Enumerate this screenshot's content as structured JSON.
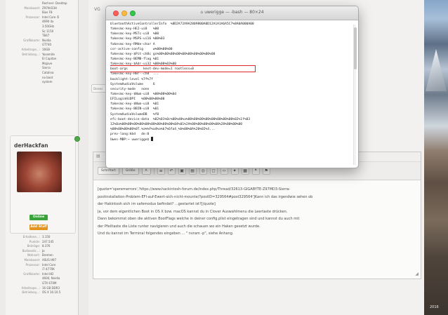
{
  "terminal": {
    "title": "uwerigge — -bash — 80×24",
    "lines": [
      "bluetoothActiveControllerInfo  %8D2A72A9A2809800A0D12A1A1A6A5C7%8A0A000A00",
      "fakesmc-key-HE2-ui8   %00",
      "fakesmc-key-MSTc-ui8  %00",
      "fakesmc-key-MSPS-ui16 %00%03",
      "fakesmc-key-RMde-char A",
      "csr-active-config     w%00%00%00",
      "fakesmc-key-$Pit-ch8c gs%00%00%00%00%00%00%00%00%00%00",
      "fakesmc-key-BEMB-flag %01",
      "fakesmc-key-$Adr-ui32 %00%00%03%00"
    ],
    "highlight_line": "boot-args        kext-dev-mode=1 rootless=0",
    "lines_after": [
      "fakesmc-key-RBr--ch8  ...",
      "backlight-level %7f%7f",
      "SystemAudioVolume     6",
      "security-mode   none",
      "fakesmc-key-$Num-ui8  %00%00%00%0d",
      "EFILoginHiDPI   %00%00%00%00",
      "fakesmc-key-$Num-ui8  %01",
      "fakesmc-key-BBIN-ui8  %01",
      "SystemAudioVolumeDB   %f0",
      "efi-boot-device-data  %02%01%0c%00%d0%a%00%00%00%00%00%00%00%00%02%1f%03",
      "12%0a%00%00%00%00%00%00%00%00%00%04%01%2A%00%00%00%00%00%28%00%00%00",
      "%00%00%00%00%0T.%a%%F%a4%a%b7%6fa4_%b%00%0A%20%02%4...",
      "prev-lang:kbd   de:0",
      "Uwes-MBP:~ uwerigge$ "
    ]
  },
  "forum": {
    "vg_label": "VG",
    "left_top_info": [
      {
        "k": "",
        "v": "Rechner: Desktop"
      },
      {
        "k": "Mainboard:",
        "v": "Z97N-D3H"
      },
      {
        "k": "",
        "v": "Bios F8"
      },
      {
        "k": "Prozessor:",
        "v": "Intel Core i5"
      },
      {
        "k": "",
        "v": "4690 4x"
      },
      {
        "k": "",
        "v": "3.50GHz"
      },
      {
        "k": "",
        "v": "Sc 1150"
      },
      {
        "k": "",
        "v": "TB47"
      },
      {
        "k": "Grafikkarte:",
        "v": "Nvidia"
      },
      {
        "k": "",
        "v": "GT740"
      },
      {
        "k": "Arbeitsspe...:",
        "v": "16GB"
      },
      {
        "k": "Betriebssy...:",
        "v": "Yosemite"
      },
      {
        "k": "",
        "v": "El Capitan"
      },
      {
        "k": "",
        "v": "Mojave"
      },
      {
        "k": "",
        "v": "Sierra"
      },
      {
        "k": "",
        "v": "Catalina"
      },
      {
        "k": "",
        "v": "no boot"
      },
      {
        "k": "",
        "v": "system"
      }
    ],
    "username": "derHackfan",
    "badge_online": "Online",
    "badge_rank": "Add Staff",
    "left_bottom_info": [
      {
        "k": "Erhaltene...:",
        "v": "3.150"
      },
      {
        "k": "Punkte:",
        "v": "247.545"
      },
      {
        "k": "Beiträge:",
        "v": "8.376"
      },
      {
        "k": "Barbeodic...:",
        "v": "Ja"
      },
      {
        "k": "Wohnort:",
        "v": "Bremen"
      },
      {
        "k": "Mainboard:",
        "v": "ASUS H97"
      },
      {
        "k": "Prozessor:",
        "v": "Intel Core"
      },
      {
        "k": "",
        "v": "i7-4770K"
      },
      {
        "k": "Grafikkarte:",
        "v": "Intel HD"
      },
      {
        "k": "",
        "v": "4600, Nvidia"
      },
      {
        "k": "",
        "v": "GTX 670M"
      },
      {
        "k": "Arbeitsspe...:",
        "v": "16 GB DDR3"
      },
      {
        "k": "Betriebssy...:",
        "v": "OS X 10.10.5"
      }
    ],
    "quick_reply": "Dieses",
    "editor": {
      "toolbar": {
        "format": "Schriftart",
        "size": "Größe",
        "font_color": "A",
        "buttons": [
          "≡",
          "↶",
          "▣",
          "▤",
          "◎",
          "◻",
          "‹›",
          "✦",
          "▦",
          "❝",
          "⚑"
        ]
      },
      "paragraphs": [
        "[quote='speremerrors','https://www.hackintosh-forum.de/index.php/Thread/32613-GIGABYTE-Z97MD3-Sierra-",
        "postinstallation-Problem-EFI-auf-Ewert-sich-nicht-mounte/?postID=329564#post329564']Kann ich das irgendwie sehen ob",
        "der Hakintosh sich im safemodus befindet? ...gestartet ist?[/quote]",
        "Ja, vor dem eigentlichen Boot in OS X bzw. macOS kannst du in Clover Auswahlmenu die Leertaste drücken.",
        "Dann bekommst oben die aktiven BootFlags welche in deiner config.plist eingetragen sind und kannst du auch mit",
        "der Pfeiltaste die Liste runter navigieren und auch die schauen wo ein Haken gesetzt wurde.",
        "Und du kannst im Terminal folgendes eingeben ... \" nvram -p\", siehe Anhang."
      ]
    }
  },
  "wallpaper": {
    "year": "2016"
  }
}
